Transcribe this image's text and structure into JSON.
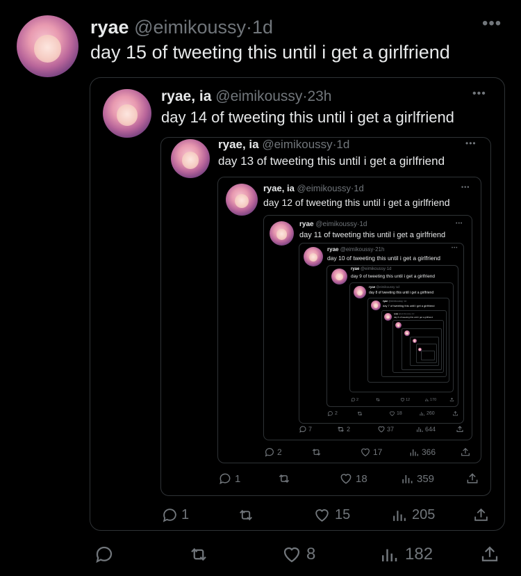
{
  "outer": {
    "name": "ryae",
    "handle": "@eimikoussy",
    "time": "1d",
    "text": "day 15 of tweeting this until i get a girlfriend",
    "replies": "",
    "likes": "8",
    "views": "182"
  },
  "q14": {
    "name": "ryae, ia",
    "handle": "@eimikoussy",
    "time": "23h",
    "text": "day 14 of tweeting this until i get a girlfriend",
    "replies": "1",
    "likes": "15",
    "views": "205"
  },
  "q13": {
    "name": "ryae, ia",
    "handle": "@eimikoussy",
    "time": "1d",
    "text": "day 13 of tweeting this until i get a girlfriend",
    "replies": "1",
    "likes": "18",
    "views": "359"
  },
  "q12": {
    "name": "ryae, ia",
    "handle": "@eimikoussy",
    "time": "1d",
    "text": "day 12 of tweeting this until i get a girlfriend",
    "replies": "2",
    "likes": "17",
    "views": "366"
  },
  "q11": {
    "name": "ryae",
    "handle": "@eimikoussy",
    "time": "1d",
    "text": "day 11 of tweeting this until i get a girlfriend",
    "replies": "7",
    "retweets": "2",
    "likes": "37",
    "views": "644"
  },
  "q10": {
    "name": "ryae",
    "handle": "@eimikoussy",
    "time": "21h",
    "text": "day 10 of tweeting this until i get a girlfriend",
    "replies": "2",
    "likes": "18",
    "views": "260"
  },
  "q9": {
    "name": "ryae",
    "handle": "@eimikoussy",
    "time": "1d",
    "text": "day 9 of tweeting this until i get a girlfriend",
    "replies": "2",
    "likes": "12",
    "views": "170"
  },
  "q8": {
    "name": "ryae",
    "handle": "@eimikoussy",
    "time": "1d",
    "text": "day 8 of tweeting this until i get a girlfriend"
  },
  "q7": {
    "name": "ryae",
    "handle": "@eimikoussy",
    "time": "1d",
    "text": "day 7 of tweeting this until i get a girlfriend"
  },
  "q6": {
    "name": "ryae",
    "handle": "@eimikoussy",
    "time": "1d",
    "text": "day 6 of tweeting this until i get a girlfriend"
  }
}
